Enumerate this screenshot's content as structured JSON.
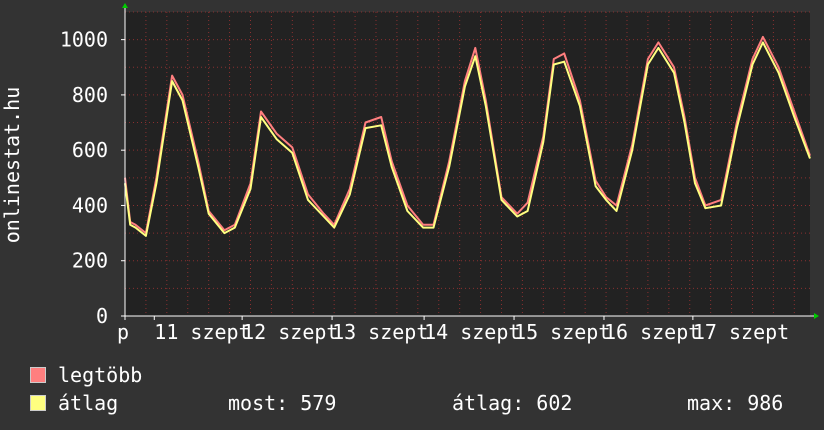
{
  "chart_data": {
    "type": "line",
    "ylabel": "onlinestat.hu",
    "ylim": [
      0,
      1100
    ],
    "yticks": [
      0,
      200,
      400,
      600,
      800,
      1000
    ],
    "xlim": [
      0,
      6.55
    ],
    "xtick_labels": [
      {
        "x": 0,
        "label": "p"
      },
      {
        "x": 0.28,
        "label": "11 szept"
      },
      {
        "x": 1.12,
        "label": "12 szept"
      },
      {
        "x": 1.98,
        "label": "13 szept"
      },
      {
        "x": 2.86,
        "label": "14 szept"
      },
      {
        "x": 3.72,
        "label": "15 szept"
      },
      {
        "x": 4.58,
        "label": "16 szept"
      },
      {
        "x": 5.43,
        "label": "17 szept"
      }
    ],
    "grid": true,
    "colors": {
      "plot_bg": "#222222",
      "grid": "#8a3030",
      "axis": "#ffffff",
      "arrow": "#00cc00"
    },
    "series": [
      {
        "name": "legtöbb",
        "color": "#ff7f7f",
        "x": [
          0,
          0.05,
          0.1,
          0.2,
          0.3,
          0.45,
          0.55,
          0.7,
          0.8,
          0.95,
          1.05,
          1.2,
          1.3,
          1.45,
          1.6,
          1.75,
          1.9,
          2.0,
          2.15,
          2.3,
          2.45,
          2.55,
          2.7,
          2.85,
          2.95,
          3.1,
          3.25,
          3.35,
          3.45,
          3.6,
          3.75,
          3.85,
          4.0,
          4.1,
          4.2,
          4.35,
          4.5,
          4.6,
          4.7,
          4.85,
          5.0,
          5.1,
          5.25,
          5.35,
          5.45,
          5.55,
          5.7,
          5.85,
          6.0,
          6.1,
          6.25,
          6.4,
          6.55
        ],
        "values": [
          500,
          340,
          330,
          300,
          500,
          870,
          800,
          560,
          380,
          310,
          330,
          480,
          740,
          660,
          610,
          440,
          370,
          330,
          460,
          700,
          720,
          560,
          400,
          330,
          330,
          560,
          850,
          970,
          780,
          430,
          370,
          410,
          650,
          930,
          950,
          780,
          490,
          430,
          400,
          620,
          930,
          990,
          900,
          720,
          500,
          400,
          420,
          700,
          930,
          1010,
          900,
          740,
          580
        ]
      },
      {
        "name": "átlag",
        "color": "#ffff80",
        "x": [
          0,
          0.05,
          0.1,
          0.2,
          0.3,
          0.45,
          0.55,
          0.7,
          0.8,
          0.95,
          1.05,
          1.2,
          1.3,
          1.45,
          1.6,
          1.75,
          1.9,
          2.0,
          2.15,
          2.3,
          2.45,
          2.55,
          2.7,
          2.85,
          2.95,
          3.1,
          3.25,
          3.35,
          3.45,
          3.6,
          3.75,
          3.85,
          4.0,
          4.1,
          4.2,
          4.35,
          4.5,
          4.6,
          4.7,
          4.85,
          5.0,
          5.1,
          5.25,
          5.35,
          5.45,
          5.55,
          5.7,
          5.85,
          6.0,
          6.1,
          6.25,
          6.4,
          6.55
        ],
        "values": [
          480,
          330,
          320,
          290,
          480,
          850,
          780,
          540,
          370,
          300,
          320,
          460,
          720,
          640,
          590,
          420,
          360,
          320,
          440,
          680,
          690,
          540,
          380,
          320,
          320,
          540,
          830,
          940,
          760,
          420,
          360,
          380,
          630,
          910,
          920,
          760,
          470,
          420,
          380,
          600,
          910,
          970,
          880,
          700,
          480,
          390,
          400,
          680,
          910,
          990,
          880,
          720,
          570
        ]
      }
    ]
  },
  "legend": {
    "items": [
      {
        "label": "legtöbb",
        "color": "#ff7f7f"
      },
      {
        "label": "átlag",
        "color": "#ffff80"
      }
    ],
    "stats": {
      "now": "most: 579",
      "avg": "átlag: 602",
      "max": "max: 986"
    }
  }
}
